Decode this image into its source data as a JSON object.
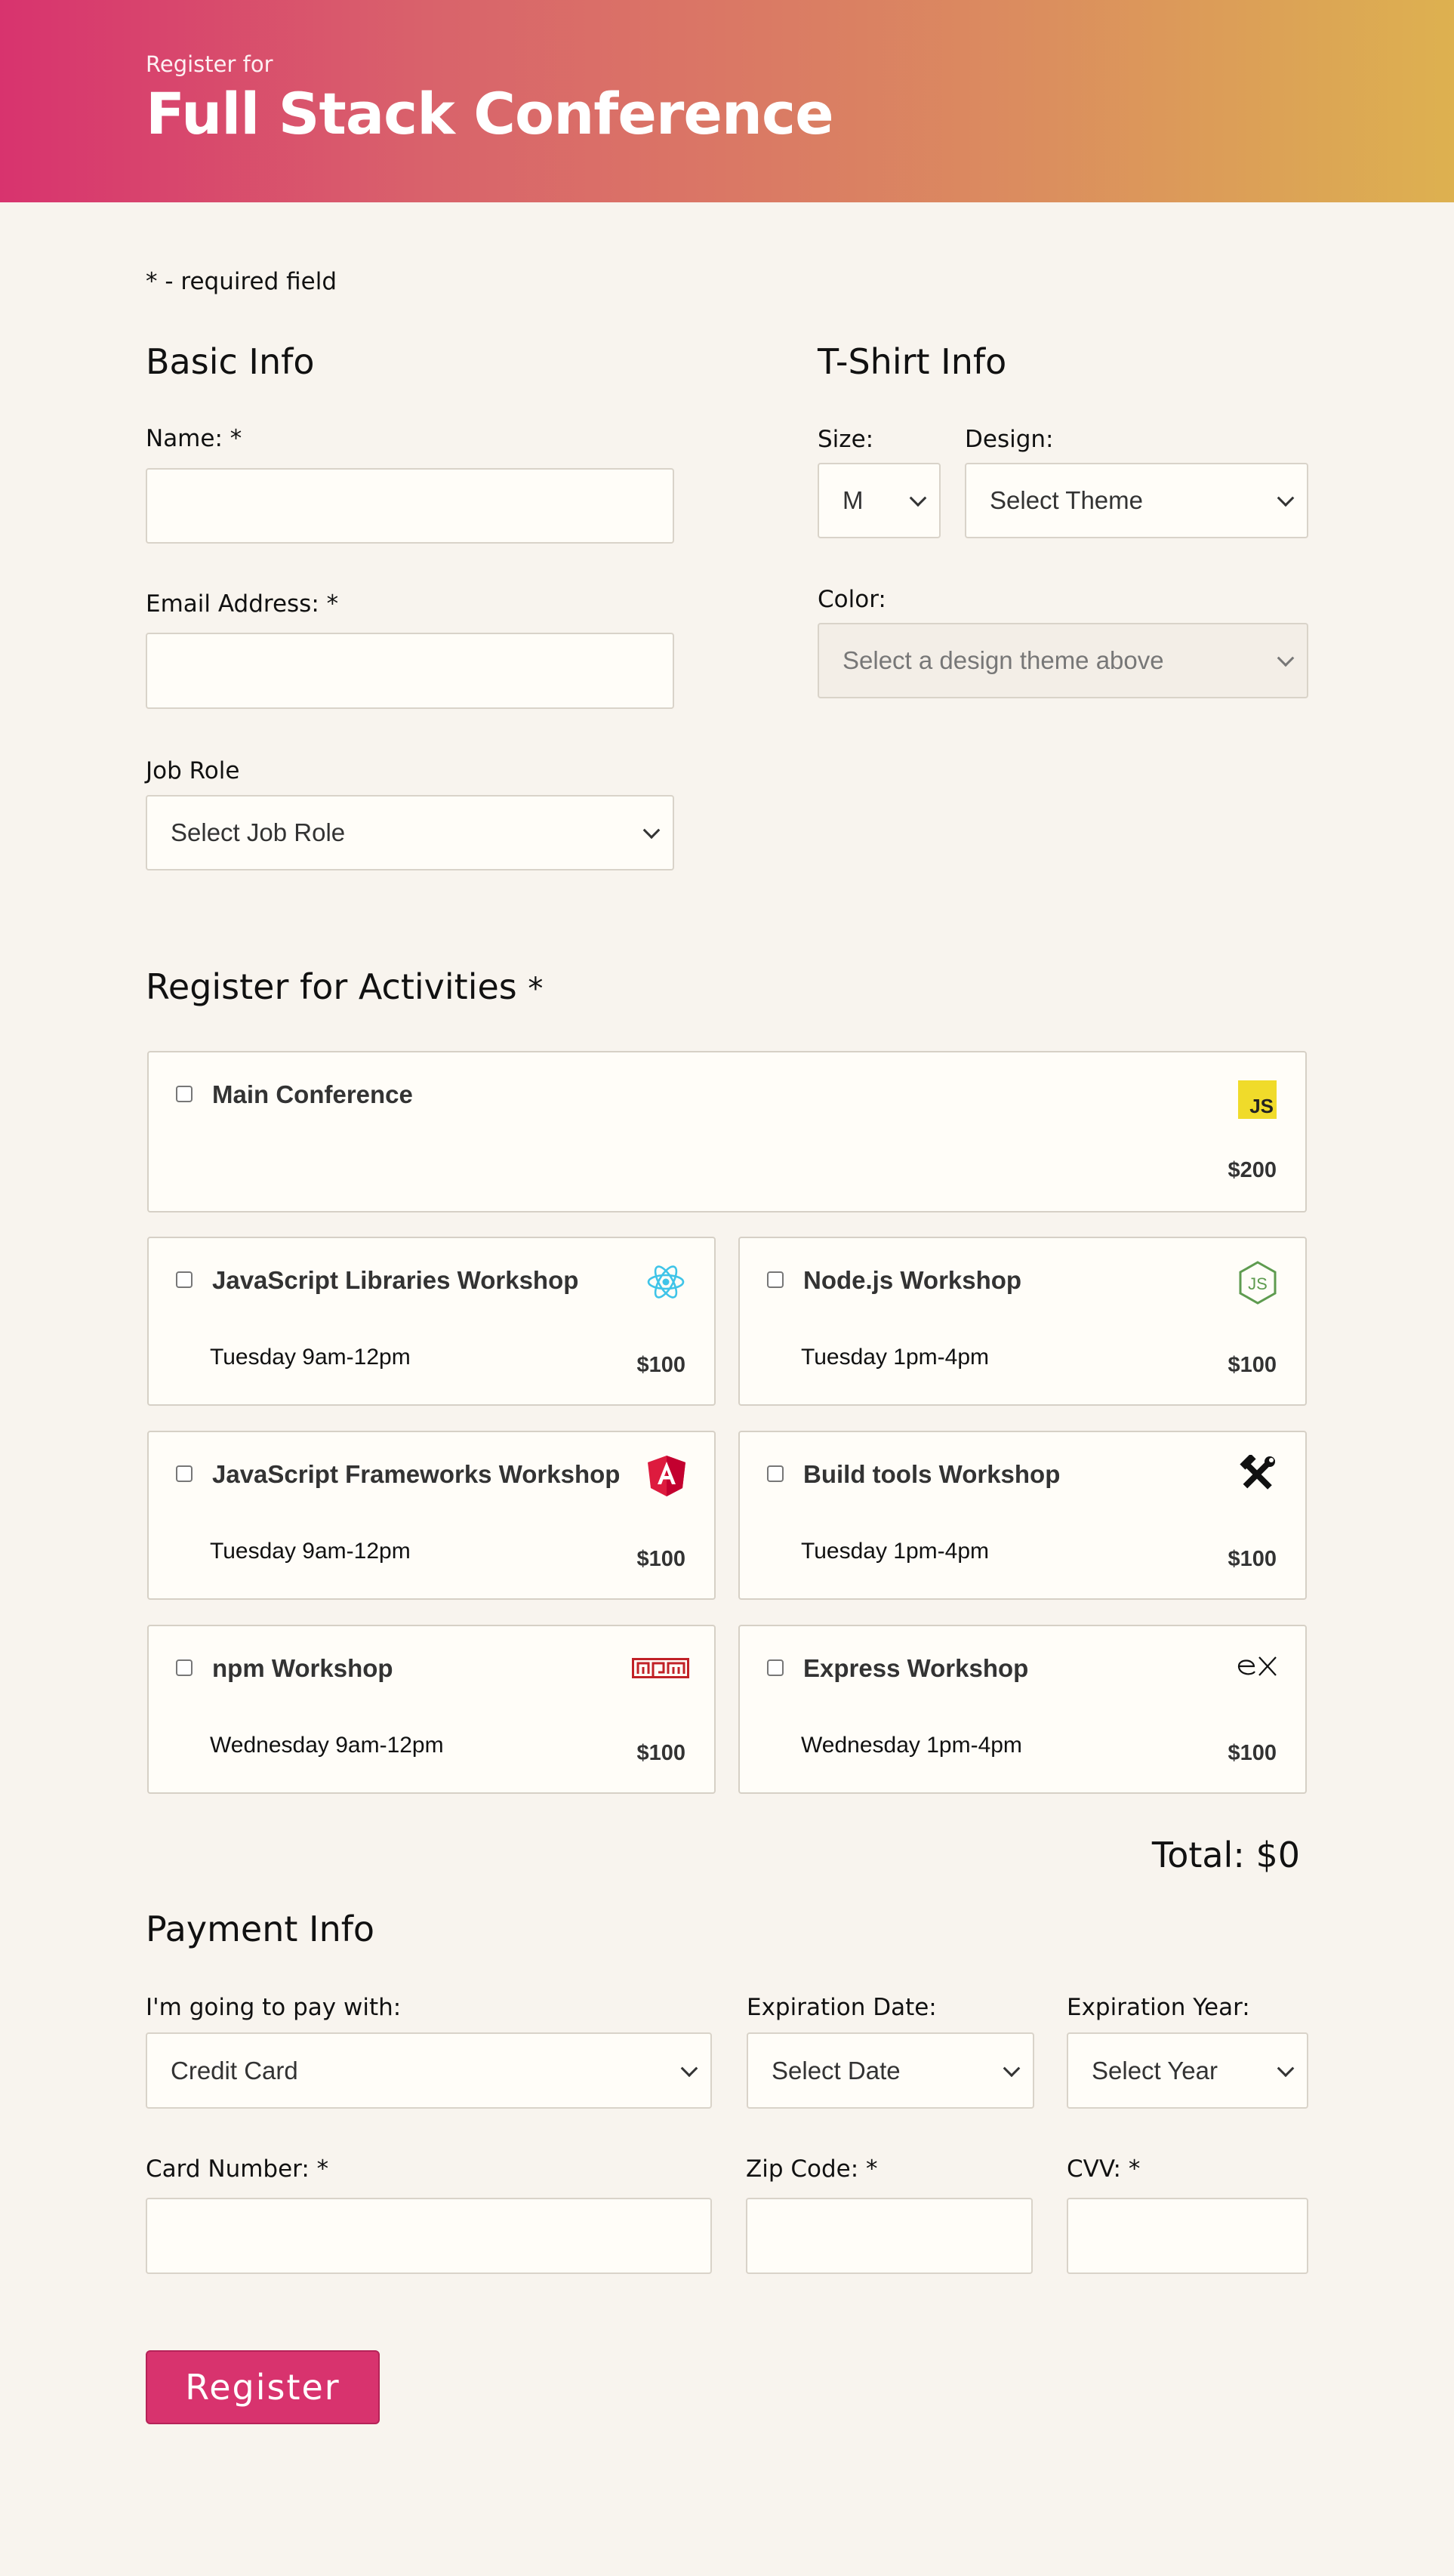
{
  "header": {
    "subtitle": "Register for",
    "title": "Full Stack Conference"
  },
  "required_note": "* - required field",
  "basic_info": {
    "heading": "Basic Info",
    "name_label": "Name:",
    "email_label": "Email Address:",
    "job_role_label": "Job Role",
    "job_role_value": "Select Job Role"
  },
  "tshirt": {
    "heading": "T-Shirt Info",
    "size_label": "Size:",
    "size_value": "M",
    "design_label": "Design:",
    "design_value": "Select Theme",
    "color_label": "Color:",
    "color_value": "Select a design theme above"
  },
  "activities": {
    "heading": "Register for Activities",
    "items": [
      {
        "title": "Main Conference",
        "time": "",
        "price": "$200",
        "icon": "javascript-icon"
      },
      {
        "title": "JavaScript Libraries Workshop",
        "time": "Tuesday 9am-12pm",
        "price": "$100",
        "icon": "react-icon"
      },
      {
        "title": "Node.js Workshop",
        "time": "Tuesday 1pm-4pm",
        "price": "$100",
        "icon": "nodejs-icon"
      },
      {
        "title": "JavaScript Frameworks Workshop",
        "time": "Tuesday 9am-12pm",
        "price": "$100",
        "icon": "angular-icon"
      },
      {
        "title": "Build tools Workshop",
        "time": "Tuesday 1pm-4pm",
        "price": "$100",
        "icon": "tools-icon"
      },
      {
        "title": "npm Workshop",
        "time": "Wednesday 9am-12pm",
        "price": "$100",
        "icon": "npm-icon"
      },
      {
        "title": "Express Workshop",
        "time": "Wednesday 1pm-4pm",
        "price": "$100",
        "icon": "express-icon"
      }
    ],
    "total": "Total: $0"
  },
  "payment": {
    "heading": "Payment Info",
    "method_label": "I'm going to pay with:",
    "method_value": "Credit Card",
    "exp_date_label": "Expiration Date:",
    "exp_date_value": "Select Date",
    "exp_year_label": "Expiration Year:",
    "exp_year_value": "Select Year",
    "card_label": "Card Number:",
    "zip_label": "Zip Code:",
    "cvv_label": "CVV:"
  },
  "register_button": "Register",
  "colors": {
    "accent": "#d8336e",
    "background": "#f8f4ee",
    "field_bg": "#fffdf8"
  }
}
